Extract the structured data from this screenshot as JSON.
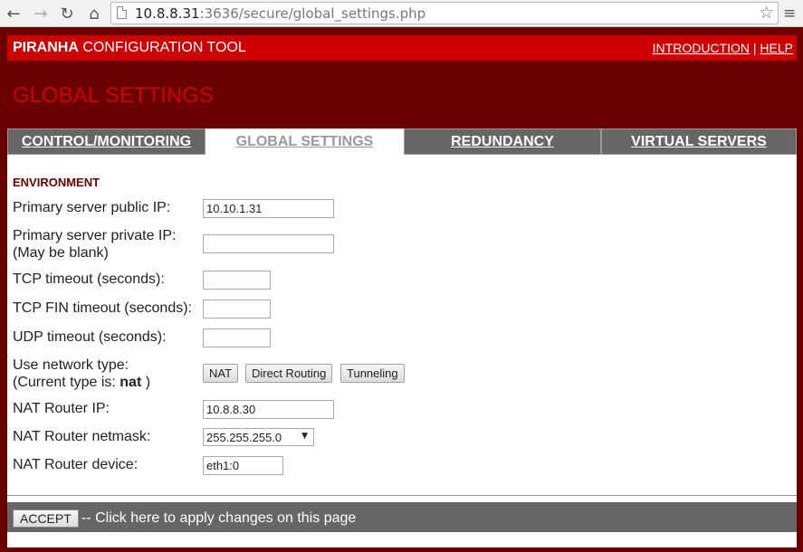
{
  "browser": {
    "url_host": "10.8.8.31",
    "url_path": ":3636/secure/global_settings.php"
  },
  "header": {
    "title_bold": "PIRANHA",
    "title_rest": " CONFIGURATION TOOL",
    "links": [
      "INTRODUCTION",
      "HELP"
    ],
    "separator": "|"
  },
  "page_title": "GLOBAL SETTINGS",
  "tabs": [
    {
      "label": "CONTROL/MONITORING"
    },
    {
      "label": "GLOBAL SETTINGS"
    },
    {
      "label": "REDUNDANCY"
    },
    {
      "label": "VIRTUAL SERVERS"
    }
  ],
  "form": {
    "section": "ENVIRONMENT",
    "primary_public_ip": {
      "label": "Primary server public IP:",
      "value": "10.10.1.31"
    },
    "primary_private_ip": {
      "label": "Primary server private IP:",
      "hint": "(May be blank)",
      "value": ""
    },
    "tcp_timeout": {
      "label": "TCP timeout (seconds):",
      "value": ""
    },
    "tcp_fin_timeout": {
      "label": "TCP FIN timeout (seconds):",
      "value": ""
    },
    "udp_timeout": {
      "label": "UDP timeout (seconds):",
      "value": ""
    },
    "network_type": {
      "label": "Use network type:",
      "current_prefix": "(Current type is: ",
      "current_value": "nat",
      "current_suffix": " )",
      "buttons": [
        "NAT",
        "Direct Routing",
        "Tunneling"
      ]
    },
    "nat_router_ip": {
      "label": "NAT Router IP:",
      "value": "10.8.8.30"
    },
    "nat_router_netmask": {
      "label": "NAT Router netmask:",
      "value": "255.255.255.0"
    },
    "nat_router_device": {
      "label": "NAT Router device:",
      "value": "eth1:0"
    }
  },
  "footer": {
    "accept_label": "ACCEPT",
    "accept_text": "-- Click here to apply changes on this page"
  }
}
